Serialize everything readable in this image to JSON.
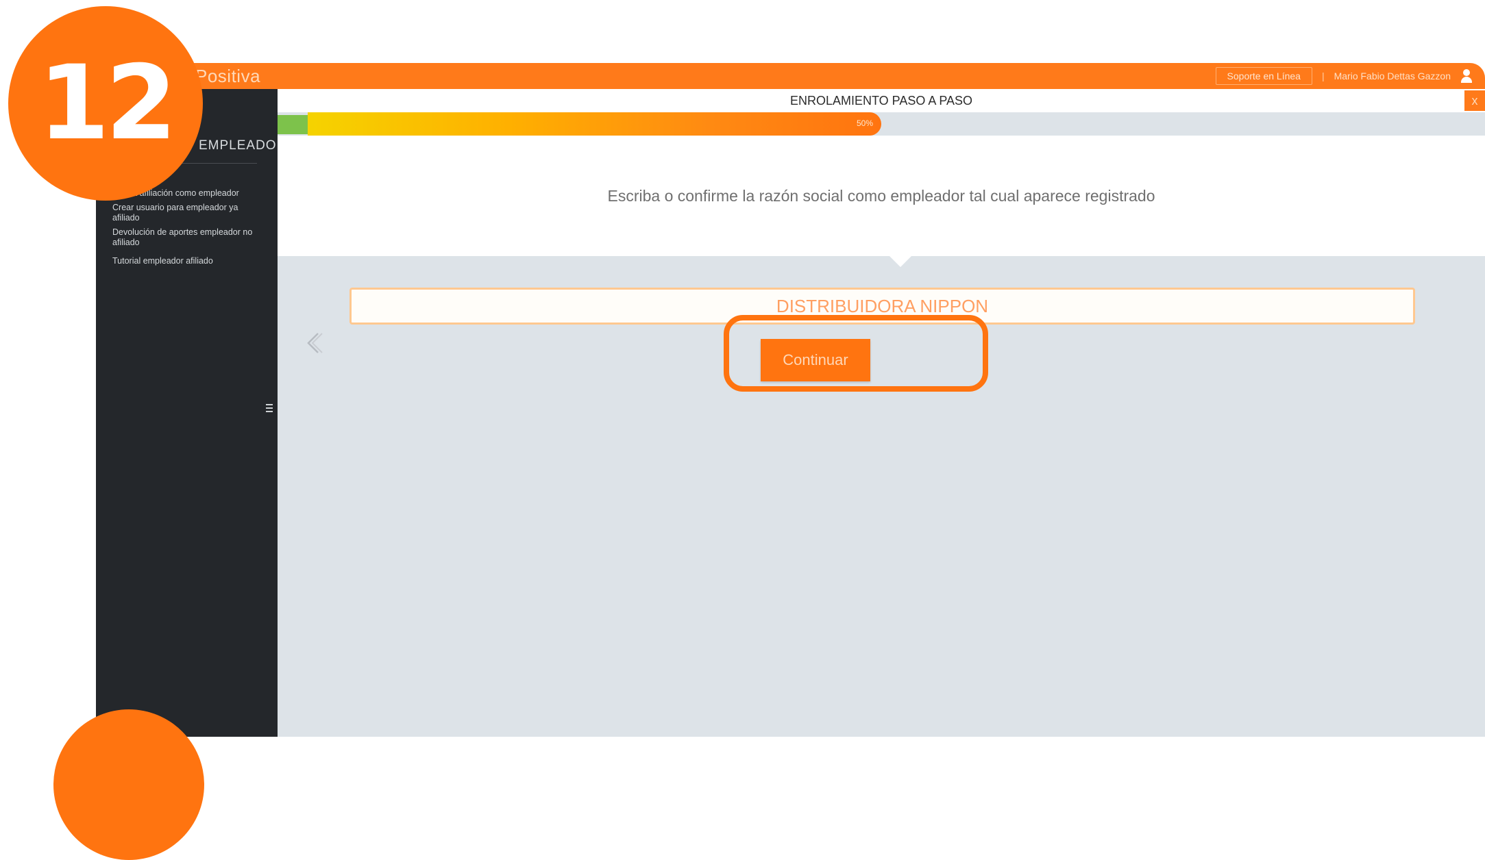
{
  "badge": {
    "number": "12"
  },
  "app": {
    "brand": "Positiva",
    "topbar": {
      "support_label": "Soporte en Línea",
      "user_name": "Mario Fabio Dettas Gazzon"
    },
    "sidebar": {
      "title": "EMPLEADOR",
      "items": [
        {
          "label": "Nueva afiliación como empleador"
        },
        {
          "label": "Crear usuario para empleador ya afiliado"
        },
        {
          "label": "Devolución de aportes empleador no afiliado"
        },
        {
          "label": "Tutorial empleador afiliado"
        }
      ]
    },
    "wizard": {
      "title": "ENROLAMIENTO PASO A PASO",
      "close_label": "x",
      "progress": {
        "percent": 50,
        "label": "50%"
      },
      "question": "Escriba o confirme la razón social como empleador tal cual aparece registrado",
      "input_value": "DISTRIBUIDORA NIPPON",
      "continue_label": "Continuar"
    }
  },
  "colors": {
    "accent": "#ff7410",
    "sidebar_bg": "#24272b",
    "content_bg": "#dde3e8",
    "progress_start": "#7dc24b"
  }
}
